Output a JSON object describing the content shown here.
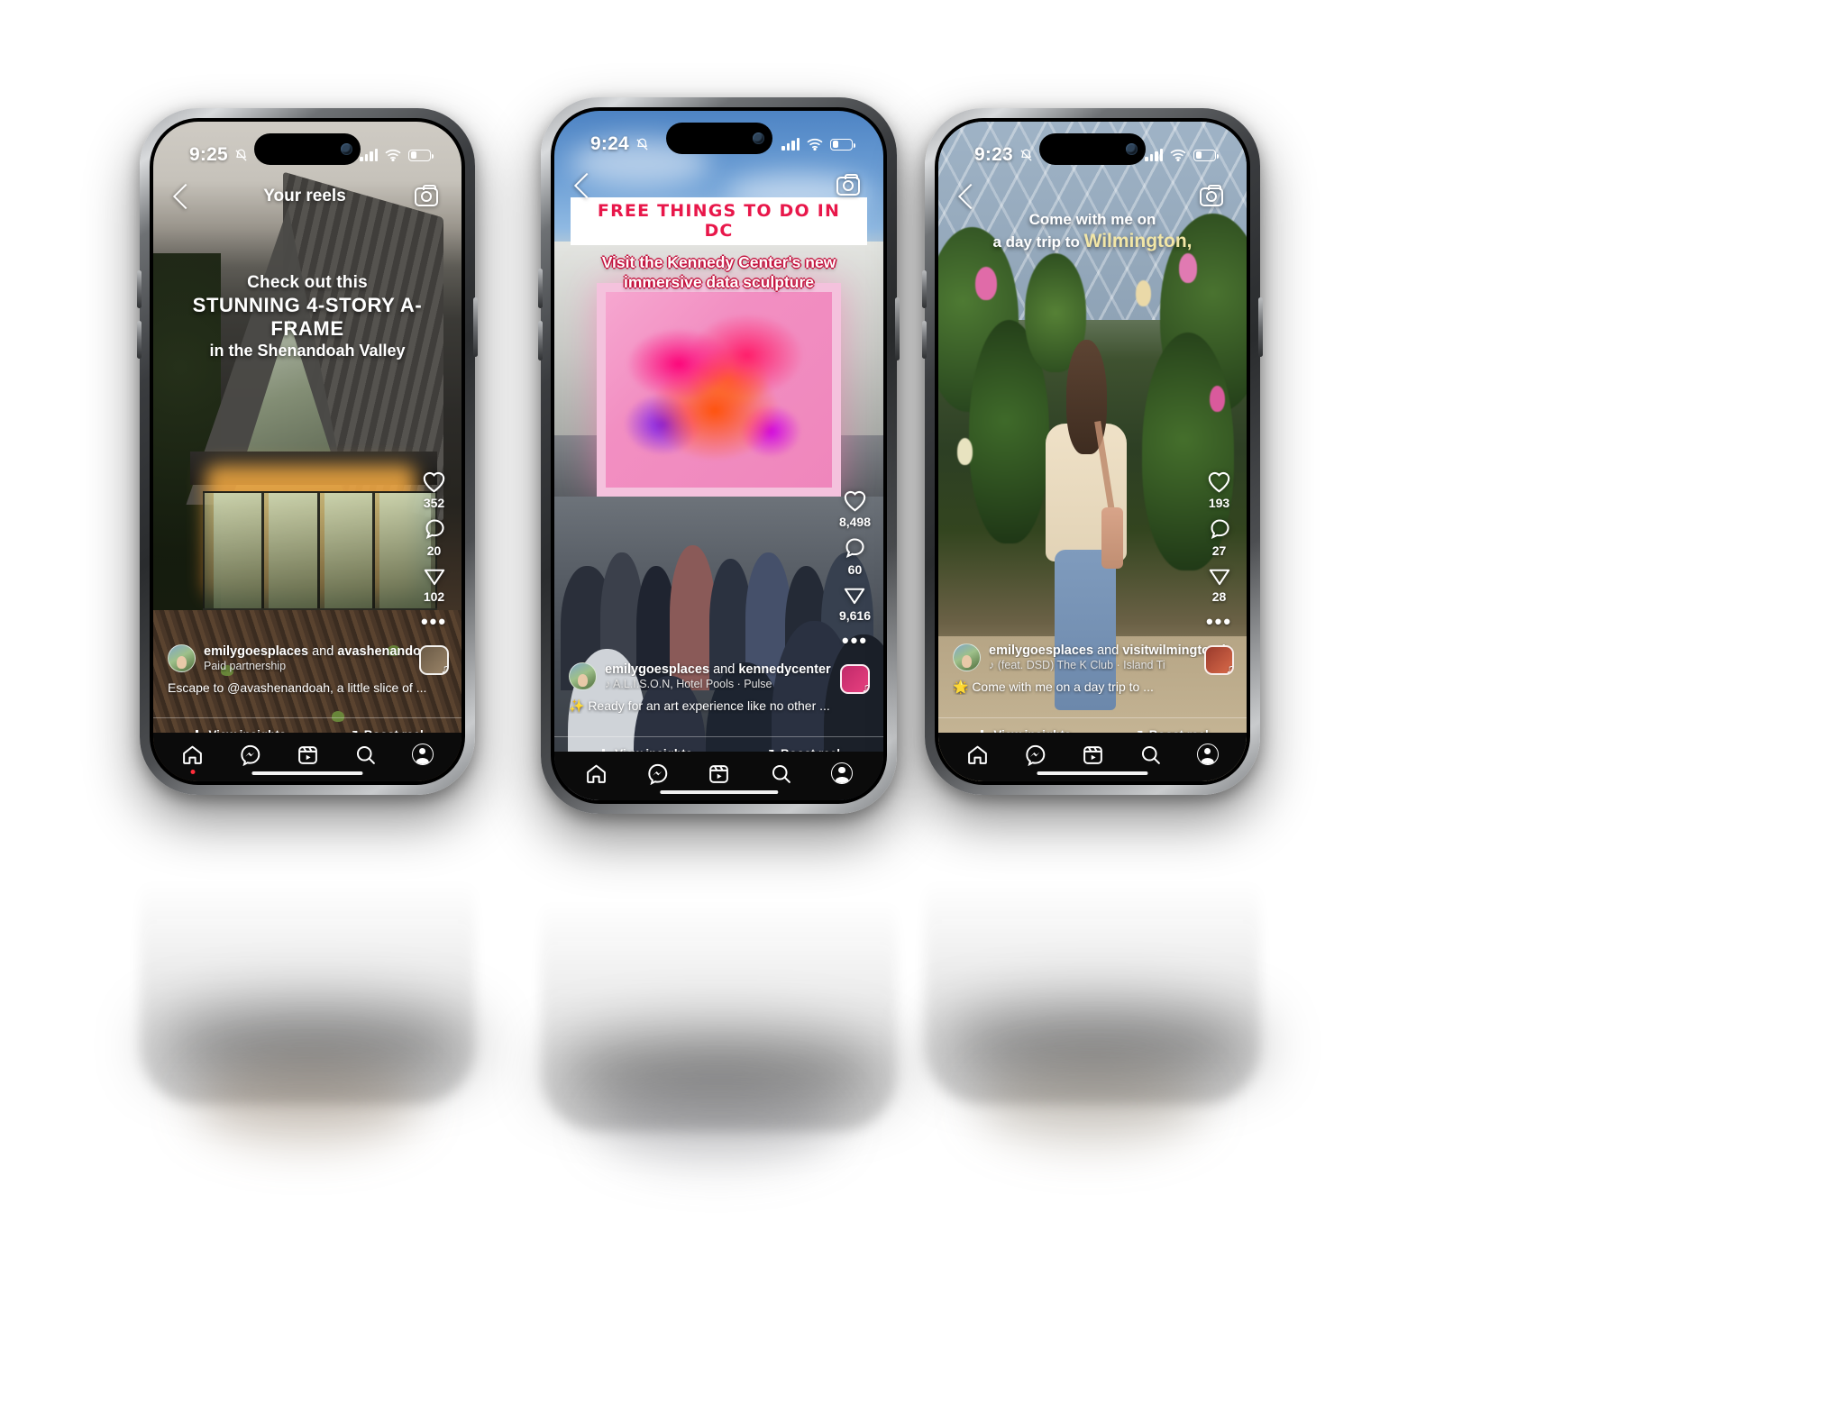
{
  "app": {
    "name": "Instagram Reels",
    "brand_accent": "#e8174a"
  },
  "phones": [
    {
      "id": "phone-left",
      "status": {
        "time": "9:25",
        "silent_icon": "bell-slash-icon",
        "signal": "cellular-bars-icon",
        "wifi": "wifi-icon",
        "battery": "battery-icon"
      },
      "topbar": {
        "back": "back-chevron-icon",
        "title": "Your reels",
        "camera": "camera-icon"
      },
      "overlay": {
        "line1": "Check out this",
        "line2": "STUNNING 4-STORY A-FRAME",
        "line3": "in the Shenandoah Valley"
      },
      "actions": {
        "like": {
          "icon": "heart-icon",
          "count": "352"
        },
        "comment": {
          "icon": "comment-icon",
          "count": "20"
        },
        "share": {
          "icon": "share-icon",
          "count": "102"
        },
        "more": {
          "icon": "more-dots-icon"
        },
        "audio": {
          "icon": "audio-thumbnail-icon",
          "note": "music-note-icon"
        }
      },
      "caption": {
        "username": "emilygoesplaces",
        "connector": " and ",
        "collab": "avashenandoah",
        "subtitle": "Paid partnership",
        "text": "Escape to @avashenandoah, a little slice of ..."
      },
      "insights": {
        "view_insights": "View insights",
        "boost_reel": "Boost reel"
      },
      "tabs": [
        {
          "name": "home",
          "icon": "home-icon",
          "badge": true
        },
        {
          "name": "messenger",
          "icon": "messenger-icon",
          "badge": false
        },
        {
          "name": "reels",
          "icon": "reels-icon",
          "badge": false
        },
        {
          "name": "search",
          "icon": "search-icon",
          "badge": false
        },
        {
          "name": "profile",
          "icon": "profile-avatar-icon",
          "badge": false
        }
      ]
    },
    {
      "id": "phone-center",
      "status": {
        "time": "9:24",
        "silent_icon": "bell-slash-icon",
        "signal": "cellular-bars-icon",
        "wifi": "wifi-icon",
        "battery": "battery-icon"
      },
      "topbar": {
        "back": "back-chevron-icon",
        "title": "",
        "camera": "camera-icon"
      },
      "overlay": {
        "badge": "FREE THINGS TO DO IN DC",
        "line1": "Visit the Kennedy Center's new",
        "line2": "immersive data sculpture"
      },
      "actions": {
        "like": {
          "icon": "heart-icon",
          "count": "8,498"
        },
        "comment": {
          "icon": "comment-icon",
          "count": "60"
        },
        "share": {
          "icon": "share-icon",
          "count": "9,616"
        },
        "more": {
          "icon": "more-dots-icon"
        },
        "audio": {
          "icon": "audio-thumbnail-icon",
          "note": "music-note-icon"
        }
      },
      "caption": {
        "username": "emilygoesplaces",
        "connector": " and ",
        "collab": "kennedycenter",
        "subtitle": "A.L.I.S.O.N, Hotel Pools · Pulse",
        "subtitle_icon": "music-note-icon",
        "text": "✨ Ready for an art experience like no other ..."
      },
      "insights": {
        "view_insights": "View insights",
        "boost_reel": "Boost reel"
      },
      "tabs": [
        {
          "name": "home",
          "icon": "home-icon",
          "badge": false
        },
        {
          "name": "messenger",
          "icon": "messenger-icon",
          "badge": false
        },
        {
          "name": "reels",
          "icon": "reels-icon",
          "badge": false
        },
        {
          "name": "search",
          "icon": "search-icon",
          "badge": false
        },
        {
          "name": "profile",
          "icon": "profile-avatar-icon",
          "badge": false
        }
      ]
    },
    {
      "id": "phone-right",
      "status": {
        "time": "9:23",
        "silent_icon": "bell-slash-icon",
        "signal": "cellular-bars-icon",
        "wifi": "wifi-icon",
        "battery": "battery-icon"
      },
      "topbar": {
        "back": "back-chevron-icon",
        "title": "",
        "camera": "camera-icon"
      },
      "overlay": {
        "line1": "Come with me on",
        "line2_pre": "a day trip to ",
        "line2_hl": "Wilmington,"
      },
      "actions": {
        "like": {
          "icon": "heart-icon",
          "count": "193"
        },
        "comment": {
          "icon": "comment-icon",
          "count": "27"
        },
        "share": {
          "icon": "share-icon",
          "count": "28"
        },
        "more": {
          "icon": "more-dots-icon"
        },
        "audio": {
          "icon": "audio-thumbnail-icon",
          "note": "music-note-icon"
        }
      },
      "caption": {
        "username": "emilygoesplaces",
        "connector": " and ",
        "collab": "visitwilmingtonde",
        "subtitle": "(feat. DSD)    The K Club · Island Ti",
        "subtitle_icon": "music-note-icon",
        "text": "🌟 Come with me on a day trip to ..."
      },
      "insights": {
        "view_insights": "View insights",
        "boost_reel": "Boost reel"
      },
      "tabs": [
        {
          "name": "home",
          "icon": "home-icon",
          "badge": false
        },
        {
          "name": "messenger",
          "icon": "messenger-icon",
          "badge": false
        },
        {
          "name": "reels",
          "icon": "reels-icon",
          "badge": false
        },
        {
          "name": "search",
          "icon": "search-icon",
          "badge": false
        },
        {
          "name": "profile",
          "icon": "profile-avatar-icon",
          "badge": false
        }
      ]
    }
  ]
}
